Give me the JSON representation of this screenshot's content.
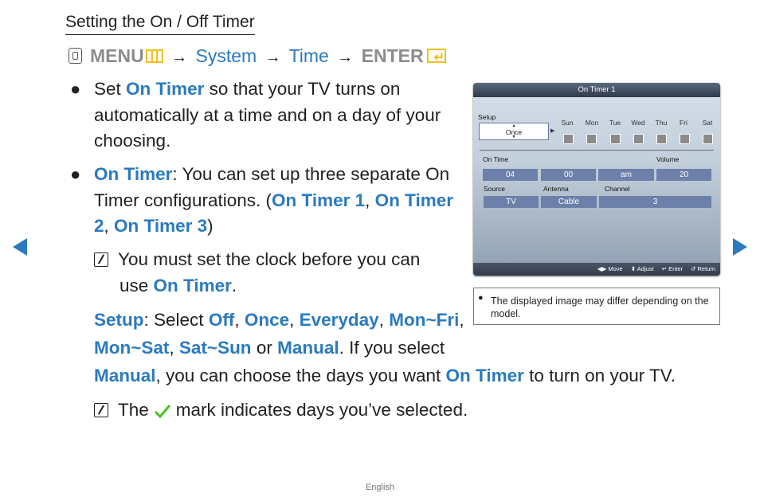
{
  "page": {
    "title": "Setting the On / Off Timer",
    "menu_path": {
      "menu": "MENU",
      "arrow": "→",
      "system": "System",
      "time": "Time",
      "enter": "ENTER"
    },
    "bullet1": {
      "pre": "Set ",
      "hl": "On Timer",
      "line1_post": " so that your TV turns on",
      "line2": "automatically at a time and on a day of your",
      "line3": "choosing."
    },
    "bullet2": {
      "hl": "On Timer",
      "line1_post": ": You can set up three separate On",
      "line2_pre": "Timer configurations. (",
      "hl_t1": "On Timer 1",
      "comma": ", ",
      "hl_t2a": "On Timer",
      "hl_t2b": "2",
      "hl_t3": "On Timer 3",
      "close": ")"
    },
    "note1": {
      "line1": "You must set the clock before you can",
      "line2_pre": "use ",
      "hl": "On Timer",
      "period": "."
    },
    "setup_para": {
      "hl_setup": "Setup",
      "select": ": Select ",
      "off": "Off",
      "once": "Once",
      "everyday": "Everyday",
      "monfri": "Mon~Fri",
      "monsat": "Mon~Sat",
      "satsun": "Sat~Sun",
      "or": " or ",
      "manual": "Manual",
      "if_select": ". If you select",
      "line3_post1": ", you can choose the days you want ",
      "on_timer": "On Timer",
      "line3_post2": " to turn on your TV.",
      "comma": ", "
    },
    "note2": {
      "pre": "The",
      "post": "mark indicates days you’ve selected."
    },
    "footer_language": "English"
  },
  "tv_screen": {
    "header": "On Timer 1",
    "setup_label": "Setup",
    "setup_value": "Once",
    "days": [
      "Sun",
      "Mon",
      "Tue",
      "Wed",
      "Thu",
      "Fri",
      "Sat"
    ],
    "on_time_label": "On Time",
    "volume_label": "Volume",
    "hour": "04",
    "minute": "00",
    "ampm": "am",
    "volume": "20",
    "source_label": "Source",
    "antenna_label": "Antenna",
    "channel_label": "Channel",
    "source": "TV",
    "antenna": "Cable",
    "channel": "3",
    "footer": {
      "move": "◀▶ Move",
      "adjust": "⬍ Adjust",
      "enter": "↵ Enter",
      "return": "↺ Return"
    }
  },
  "disclaimer": {
    "bullet": "●",
    "text": "The displayed image may differ depending on the model."
  },
  "colors": {
    "highlight": "#2a7ac0",
    "menu_grey": "#8c8c8c",
    "icon_yellow": "#f2c01c",
    "check_green": "#4cc21f"
  }
}
